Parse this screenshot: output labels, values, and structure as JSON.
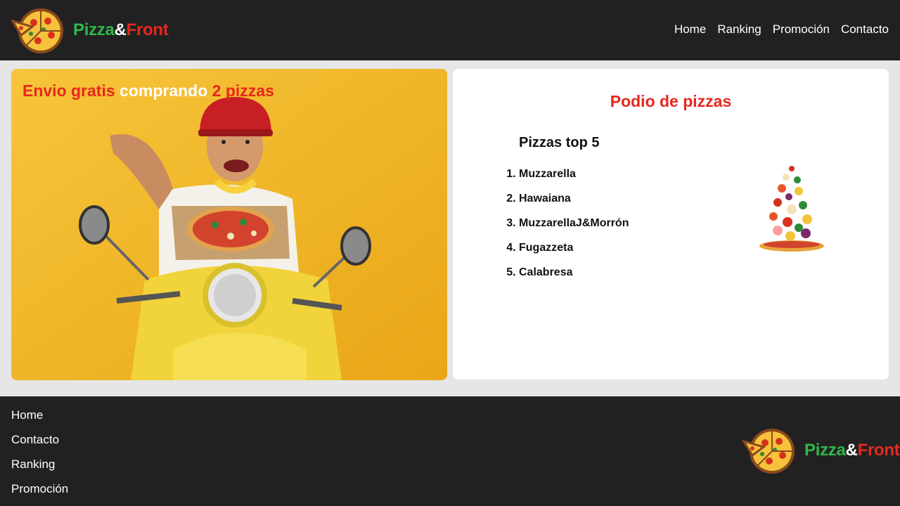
{
  "brand": {
    "part1": "Pizza",
    "part2": "&",
    "part3": "Front"
  },
  "nav": [
    {
      "label": "Home"
    },
    {
      "label": "Ranking"
    },
    {
      "label": "Promoción"
    },
    {
      "label": "Contacto"
    }
  ],
  "promo": {
    "title_part1": "Envio gratis",
    "title_part2": "comprando",
    "title_part3": "2 pizzas"
  },
  "ranking": {
    "title": "Podio de pizzas",
    "subtitle": "Pizzas top 5",
    "items": [
      {
        "num": "1",
        "name": "Muzzarella"
      },
      {
        "num": "2",
        "name": "Hawaiana"
      },
      {
        "num": "3",
        "name": "MuzzarellaJ&Morrón"
      },
      {
        "num": "4",
        "name": "Fugazzeta"
      },
      {
        "num": "5",
        "name": "Calabresa"
      }
    ]
  },
  "footer": {
    "links": [
      {
        "label": "Home"
      },
      {
        "label": "Contacto"
      },
      {
        "label": "Ranking"
      },
      {
        "label": "Promoción"
      }
    ]
  },
  "colors": {
    "header_bg": "#212121",
    "accent_red": "#e8271e",
    "accent_green": "#2eb84b",
    "promo_bg": "#f3b52c"
  }
}
